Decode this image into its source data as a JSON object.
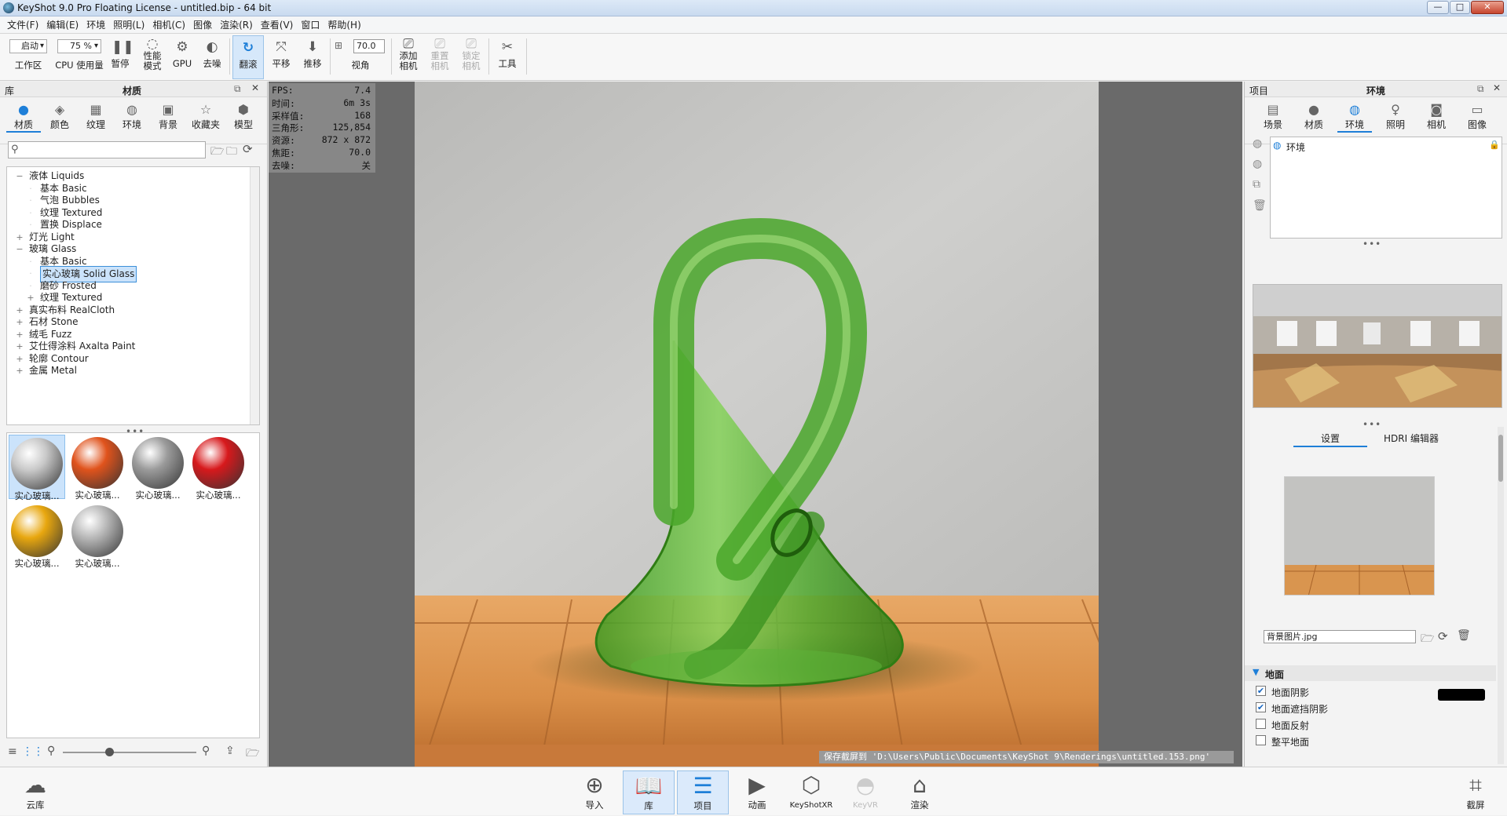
{
  "title_bar": {
    "title": "KeyShot 9.0 Pro Floating License  - untitled.bip  - 64 bit",
    "minimize": "—",
    "maximize": "□",
    "close": "✕"
  },
  "menu": [
    "文件(F)",
    "编辑(E)",
    "环境",
    "照明(L)",
    "相机(C)",
    "图像",
    "渲染(R)",
    "查看(V)",
    "窗口",
    "帮助(H)"
  ],
  "toolbar": {
    "workspace_select": "启动",
    "workspace_label": "工作区",
    "cpu_select": "75 %",
    "cpu_label": "CPU 使用量",
    "pause": "暂停",
    "perf_mode_line1": "性能",
    "perf_mode_line2": "模式",
    "gpu": "GPU",
    "denoise": "去噪",
    "tumble": "翻滚",
    "pan": "平移",
    "dolly": "推移",
    "fov_value": "70.0",
    "fov_label": "视角",
    "add_camera_line1": "添加",
    "add_camera_line2": "相机",
    "reset_camera_line1": "重置",
    "reset_camera_line2": "相机",
    "lock_camera_line1": "锁定",
    "lock_camera_line2": "相机",
    "tools": "工具"
  },
  "library": {
    "header_left": "库",
    "header_title": "材质",
    "tabs": [
      {
        "label": "材质",
        "icon": "material-icon"
      },
      {
        "label": "颜色",
        "icon": "color-icon"
      },
      {
        "label": "纹理",
        "icon": "texture-icon"
      },
      {
        "label": "环境",
        "icon": "environment-icon"
      },
      {
        "label": "背景",
        "icon": "background-icon"
      },
      {
        "label": "收藏夹",
        "icon": "favorites-icon"
      },
      {
        "label": "模型",
        "icon": "model-icon"
      }
    ],
    "search_placeholder": "",
    "tree": [
      {
        "label": "液体 Liquids",
        "level": 0,
        "expander": "−"
      },
      {
        "label": "基本 Basic",
        "level": 1,
        "expander": ""
      },
      {
        "label": "气泡 Bubbles",
        "level": 1,
        "expander": ""
      },
      {
        "label": "纹理 Textured",
        "level": 1,
        "expander": ""
      },
      {
        "label": "置换 Displace",
        "level": 1,
        "expander": ""
      },
      {
        "label": "灯光 Light",
        "level": 0,
        "expander": "+"
      },
      {
        "label": "玻璃 Glass",
        "level": 0,
        "expander": "−"
      },
      {
        "label": "基本 Basic",
        "level": 1,
        "expander": ""
      },
      {
        "label": "实心玻璃 Solid Glass",
        "level": 1,
        "expander": "",
        "selected": true
      },
      {
        "label": "磨砂 Frosted",
        "level": 1,
        "expander": ""
      },
      {
        "label": "纹理 Textured",
        "level": 1,
        "expander": "+"
      },
      {
        "label": "真实布料 RealCloth",
        "level": 0,
        "expander": "+"
      },
      {
        "label": "石材 Stone",
        "level": 0,
        "expander": "+"
      },
      {
        "label": "绒毛 Fuzz",
        "level": 0,
        "expander": "+"
      },
      {
        "label": "艾仕得涂料 Axalta Paint",
        "level": 0,
        "expander": "+"
      },
      {
        "label": "轮廓 Contour",
        "level": 0,
        "expander": "+"
      },
      {
        "label": "金属 Metal",
        "level": 0,
        "expander": "+"
      }
    ],
    "thumbnails": [
      {
        "label": "实心玻璃...",
        "color": "#c8c8c8",
        "selected": true
      },
      {
        "label": "实心玻璃...",
        "color": "#e0531c"
      },
      {
        "label": "实心玻璃...",
        "color": "#9b9b9b"
      },
      {
        "label": "实心玻璃...",
        "color": "#d7191c"
      },
      {
        "label": "实心玻璃...",
        "color": "#e8a70f"
      },
      {
        "label": "实心玻璃...",
        "color": "#b8b8b8"
      }
    ]
  },
  "hud": [
    {
      "k": "FPS:",
      "v": "7.4"
    },
    {
      "k": "时间:",
      "v": "6m 3s"
    },
    {
      "k": "采样值:",
      "v": "168"
    },
    {
      "k": "三角形:",
      "v": "125,854"
    },
    {
      "k": "资源:",
      "v": "872 x 872"
    },
    {
      "k": "焦距:",
      "v": "70.0"
    },
    {
      "k": "去噪:",
      "v": "关"
    }
  ],
  "status_message": "保存截屏到 'D:\\Users\\Public\\Documents\\KeyShot 9\\Renderings\\untitled.153.png'",
  "project": {
    "header_left": "项目",
    "header_title": "环境",
    "tabs": [
      {
        "label": "场景",
        "icon": "scene-icon"
      },
      {
        "label": "材质",
        "icon": "material-icon"
      },
      {
        "label": "环境",
        "icon": "environment-icon"
      },
      {
        "label": "照明",
        "icon": "lighting-icon"
      },
      {
        "label": "相机",
        "icon": "camera-icon"
      },
      {
        "label": "图像",
        "icon": "image-icon"
      }
    ],
    "env_list_item": "环境",
    "subtabs": [
      "设置",
      "HDRI 编辑器"
    ],
    "background_file": "背景图片.jpg",
    "ground_section": "地面",
    "ground_options": [
      {
        "label": "地面阴影",
        "checked": true
      },
      {
        "label": "地面遮挡阴影",
        "checked": true
      },
      {
        "label": "地面反射",
        "checked": false
      },
      {
        "label": "整平地面",
        "checked": false
      }
    ],
    "shadow_color": "#000000"
  },
  "bottom": {
    "cloud": "云库",
    "buttons": [
      {
        "label": "导入",
        "icon": "import-icon",
        "state": "normal"
      },
      {
        "label": "库",
        "icon": "library-icon",
        "state": "active"
      },
      {
        "label": "项目",
        "icon": "project-icon",
        "state": "active"
      },
      {
        "label": "动画",
        "icon": "animation-icon",
        "state": "normal"
      },
      {
        "label": "KeyShotXR",
        "icon": "keyshotxr-icon",
        "state": "normal"
      },
      {
        "label": "KeyVR",
        "icon": "keyvr-icon",
        "state": "disabled"
      },
      {
        "label": "渲染",
        "icon": "render-icon",
        "state": "normal"
      }
    ],
    "screenshot": "截屏"
  },
  "colors": {
    "accent": "#1e7fd8",
    "selection": "#cbe3fb"
  }
}
